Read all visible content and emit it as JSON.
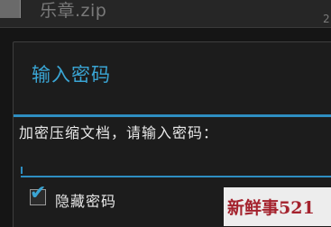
{
  "background_list": {
    "file_name": "乐章.zip",
    "meta": "2"
  },
  "dialog": {
    "title": "输入密码",
    "prompt": "加密压缩文档，请输入密码：",
    "password_value": "",
    "hide_password": {
      "label": "隐藏密码",
      "checked": true
    }
  },
  "watermark": {
    "text": "新鲜事521"
  },
  "colors": {
    "accent": "#3aa5d4",
    "divider": "#2e8ec1",
    "dialog_bg": "#1c1c1c"
  }
}
